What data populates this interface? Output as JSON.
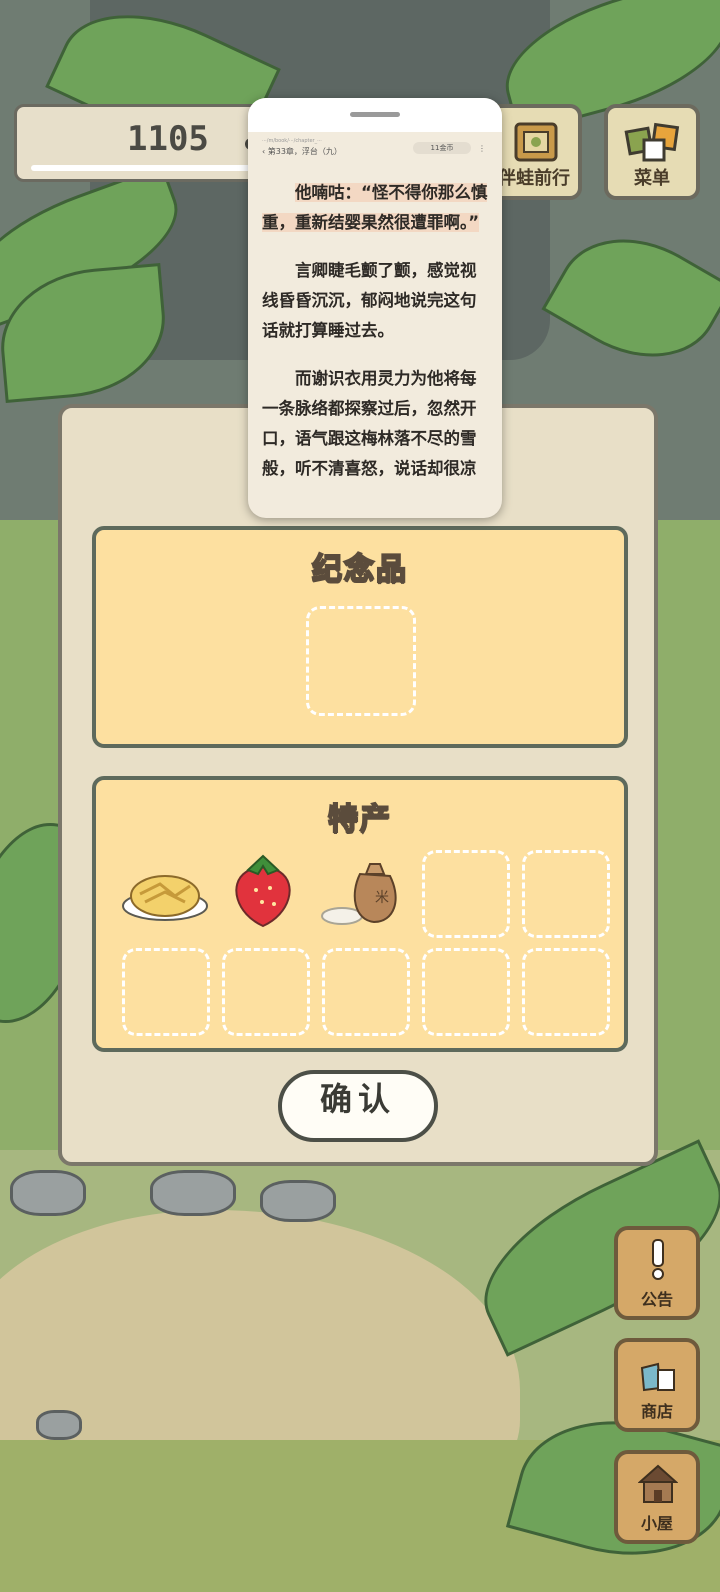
{
  "hud": {
    "clover_count": "1105"
  },
  "top_buttons": {
    "travel_label": "伴蛙前行",
    "menu_label": "菜单"
  },
  "side_buttons": {
    "notice_label": "公告",
    "shop_label": "商店",
    "house_label": "小屋"
  },
  "dialog": {
    "souvenir_title": "纪念品",
    "specialty_title": "特产",
    "specialty_items": [
      "pancake-plate-icon",
      "strawberry-icon",
      "rice-sack-icon"
    ],
    "confirm_label": "确认"
  },
  "reader": {
    "url": "···/m/book/···/chapter_···",
    "chapter": "‹ 第33章，浮台（九）",
    "coins": "11金币",
    "paragraphs": [
      "他喃咕：“怪不得你那么慎重，重新结婴果然很遭罪啊。”",
      "言卿睫毛颤了颤，感觉视线昏昏沉沉，郁闷地说完这句话就打算睡过去。",
      "而谢识衣用灵力为他将每一条脉络都探察过后，忽然开口，语气跟这梅林落不尽的雪般，听不清喜怒，说话却很凉"
    ]
  },
  "colors": {
    "panel": "#fde0a0",
    "dialog": "#e8dfc7",
    "border": "#5e6a5c"
  }
}
